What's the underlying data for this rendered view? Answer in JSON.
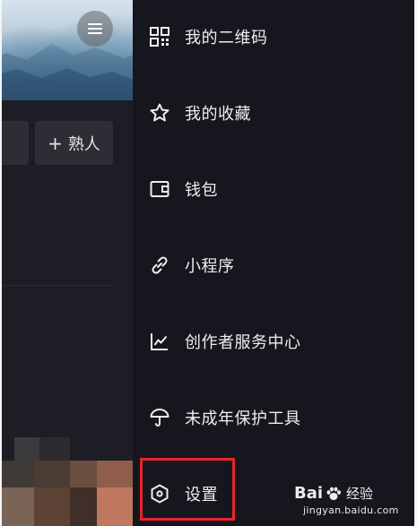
{
  "profile": {
    "add_friend_label": "熟人",
    "add_friend_plus": "+"
  },
  "drawer": {
    "items": [
      {
        "label": "我的二维码",
        "icon": "qr-code-icon"
      },
      {
        "label": "我的收藏",
        "icon": "star-icon"
      },
      {
        "label": "钱包",
        "icon": "wallet-icon"
      },
      {
        "label": "小程序",
        "icon": "link-icon"
      },
      {
        "label": "创作者服务中心",
        "icon": "chart-icon"
      },
      {
        "label": "未成年保护工具",
        "icon": "umbrella-icon"
      },
      {
        "label": "设置",
        "icon": "settings-hexagon-icon"
      }
    ]
  },
  "watermark": {
    "brand_left": "Bai",
    "brand_right": "经验",
    "url": "jingyan.baidu.com"
  },
  "colors": {
    "background": "#16161e",
    "highlight": "#e8252a",
    "text": "#eeeeee"
  }
}
